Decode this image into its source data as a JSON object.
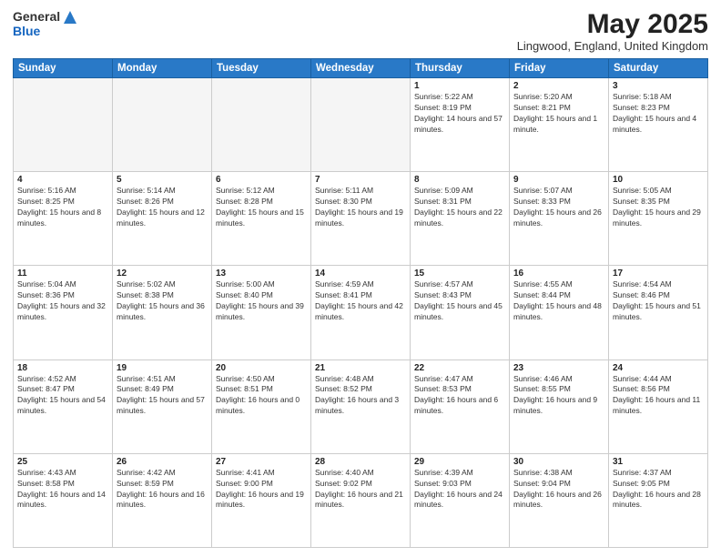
{
  "header": {
    "logo_general": "General",
    "logo_blue": "Blue",
    "month_title": "May 2025",
    "location": "Lingwood, England, United Kingdom"
  },
  "days_of_week": [
    "Sunday",
    "Monday",
    "Tuesday",
    "Wednesday",
    "Thursday",
    "Friday",
    "Saturday"
  ],
  "weeks": [
    [
      {
        "day": "",
        "empty": true
      },
      {
        "day": "",
        "empty": true
      },
      {
        "day": "",
        "empty": true
      },
      {
        "day": "",
        "empty": true
      },
      {
        "day": "1",
        "sunrise": "5:22 AM",
        "sunset": "8:19 PM",
        "daylight": "14 hours and 57 minutes."
      },
      {
        "day": "2",
        "sunrise": "5:20 AM",
        "sunset": "8:21 PM",
        "daylight": "15 hours and 1 minute."
      },
      {
        "day": "3",
        "sunrise": "5:18 AM",
        "sunset": "8:23 PM",
        "daylight": "15 hours and 4 minutes."
      }
    ],
    [
      {
        "day": "4",
        "sunrise": "5:16 AM",
        "sunset": "8:25 PM",
        "daylight": "15 hours and 8 minutes."
      },
      {
        "day": "5",
        "sunrise": "5:14 AM",
        "sunset": "8:26 PM",
        "daylight": "15 hours and 12 minutes."
      },
      {
        "day": "6",
        "sunrise": "5:12 AM",
        "sunset": "8:28 PM",
        "daylight": "15 hours and 15 minutes."
      },
      {
        "day": "7",
        "sunrise": "5:11 AM",
        "sunset": "8:30 PM",
        "daylight": "15 hours and 19 minutes."
      },
      {
        "day": "8",
        "sunrise": "5:09 AM",
        "sunset": "8:31 PM",
        "daylight": "15 hours and 22 minutes."
      },
      {
        "day": "9",
        "sunrise": "5:07 AM",
        "sunset": "8:33 PM",
        "daylight": "15 hours and 26 minutes."
      },
      {
        "day": "10",
        "sunrise": "5:05 AM",
        "sunset": "8:35 PM",
        "daylight": "15 hours and 29 minutes."
      }
    ],
    [
      {
        "day": "11",
        "sunrise": "5:04 AM",
        "sunset": "8:36 PM",
        "daylight": "15 hours and 32 minutes."
      },
      {
        "day": "12",
        "sunrise": "5:02 AM",
        "sunset": "8:38 PM",
        "daylight": "15 hours and 36 minutes."
      },
      {
        "day": "13",
        "sunrise": "5:00 AM",
        "sunset": "8:40 PM",
        "daylight": "15 hours and 39 minutes."
      },
      {
        "day": "14",
        "sunrise": "4:59 AM",
        "sunset": "8:41 PM",
        "daylight": "15 hours and 42 minutes."
      },
      {
        "day": "15",
        "sunrise": "4:57 AM",
        "sunset": "8:43 PM",
        "daylight": "15 hours and 45 minutes."
      },
      {
        "day": "16",
        "sunrise": "4:55 AM",
        "sunset": "8:44 PM",
        "daylight": "15 hours and 48 minutes."
      },
      {
        "day": "17",
        "sunrise": "4:54 AM",
        "sunset": "8:46 PM",
        "daylight": "15 hours and 51 minutes."
      }
    ],
    [
      {
        "day": "18",
        "sunrise": "4:52 AM",
        "sunset": "8:47 PM",
        "daylight": "15 hours and 54 minutes."
      },
      {
        "day": "19",
        "sunrise": "4:51 AM",
        "sunset": "8:49 PM",
        "daylight": "15 hours and 57 minutes."
      },
      {
        "day": "20",
        "sunrise": "4:50 AM",
        "sunset": "8:51 PM",
        "daylight": "16 hours and 0 minutes."
      },
      {
        "day": "21",
        "sunrise": "4:48 AM",
        "sunset": "8:52 PM",
        "daylight": "16 hours and 3 minutes."
      },
      {
        "day": "22",
        "sunrise": "4:47 AM",
        "sunset": "8:53 PM",
        "daylight": "16 hours and 6 minutes."
      },
      {
        "day": "23",
        "sunrise": "4:46 AM",
        "sunset": "8:55 PM",
        "daylight": "16 hours and 9 minutes."
      },
      {
        "day": "24",
        "sunrise": "4:44 AM",
        "sunset": "8:56 PM",
        "daylight": "16 hours and 11 minutes."
      }
    ],
    [
      {
        "day": "25",
        "sunrise": "4:43 AM",
        "sunset": "8:58 PM",
        "daylight": "16 hours and 14 minutes."
      },
      {
        "day": "26",
        "sunrise": "4:42 AM",
        "sunset": "8:59 PM",
        "daylight": "16 hours and 16 minutes."
      },
      {
        "day": "27",
        "sunrise": "4:41 AM",
        "sunset": "9:00 PM",
        "daylight": "16 hours and 19 minutes."
      },
      {
        "day": "28",
        "sunrise": "4:40 AM",
        "sunset": "9:02 PM",
        "daylight": "16 hours and 21 minutes."
      },
      {
        "day": "29",
        "sunrise": "4:39 AM",
        "sunset": "9:03 PM",
        "daylight": "16 hours and 24 minutes."
      },
      {
        "day": "30",
        "sunrise": "4:38 AM",
        "sunset": "9:04 PM",
        "daylight": "16 hours and 26 minutes."
      },
      {
        "day": "31",
        "sunrise": "4:37 AM",
        "sunset": "9:05 PM",
        "daylight": "16 hours and 28 minutes."
      }
    ]
  ]
}
